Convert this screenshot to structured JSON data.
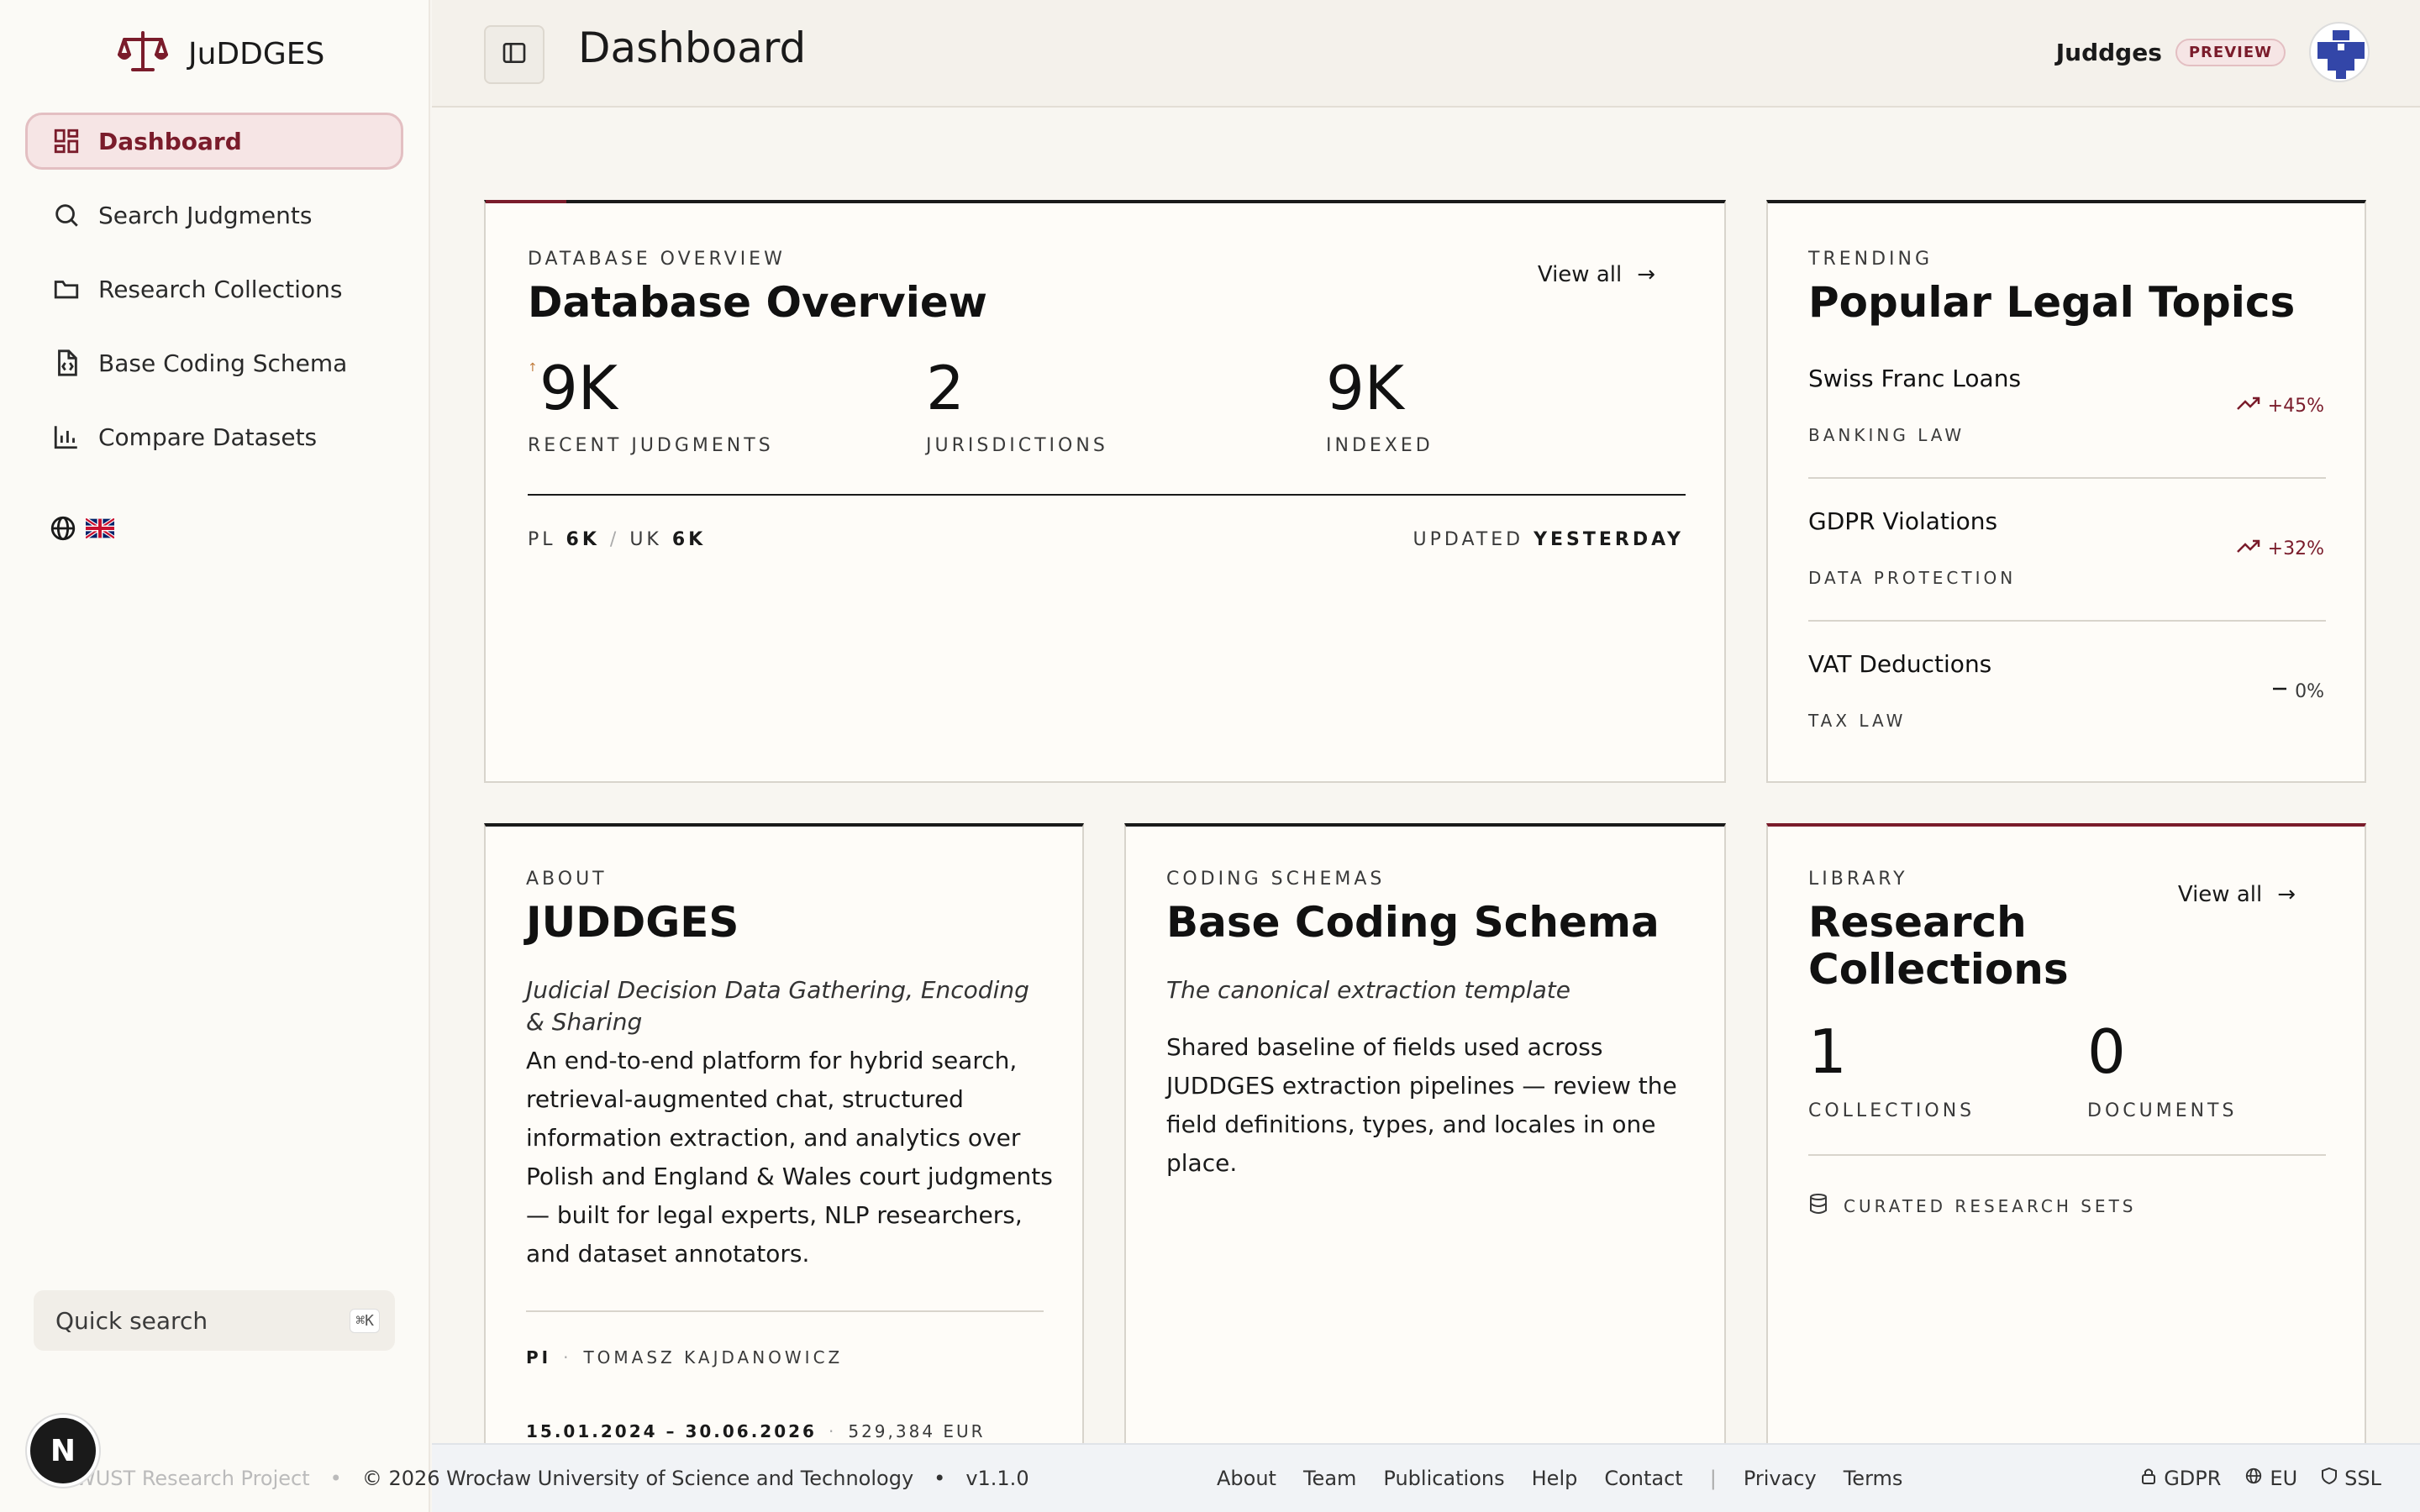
{
  "brand": {
    "name": "JuDDGES"
  },
  "sidebar": {
    "items": [
      {
        "label": "Dashboard",
        "icon": "grid-icon",
        "active": true
      },
      {
        "label": "Search Judgments",
        "icon": "search-icon"
      },
      {
        "label": "Research Collections",
        "icon": "folder-icon"
      },
      {
        "label": "Base Coding Schema",
        "icon": "file-code-icon"
      },
      {
        "label": "Compare Datasets",
        "icon": "bar-chart-icon"
      }
    ],
    "quick_search": {
      "label": "Quick search",
      "shortcut": "⌘K"
    },
    "avatar_letter": "N"
  },
  "header": {
    "title": "Dashboard",
    "user_name": "Juddges",
    "badge": "PREVIEW"
  },
  "overview": {
    "eyebrow": "DATABASE OVERVIEW",
    "title": "Database Overview",
    "view_all": "View all",
    "arrow": "→",
    "marker": "↑",
    "stats": [
      {
        "value": "9K",
        "label": "RECENT JUDGMENTS"
      },
      {
        "value": "2",
        "label": "JURISDICTIONS"
      },
      {
        "value": "9K",
        "label": "INDEXED"
      }
    ],
    "breakdown": {
      "pl_label": "PL",
      "pl_value": "6K",
      "sep": "/",
      "uk_label": "UK",
      "uk_value": "6K"
    },
    "updated_label": "UPDATED",
    "updated_value": "YESTERDAY"
  },
  "trending": {
    "eyebrow": "TRENDING",
    "title": "Popular Legal Topics",
    "topics": [
      {
        "name": "Swiss Franc Loans",
        "category": "BANKING LAW",
        "change": "+45%",
        "trend": "up"
      },
      {
        "name": "GDPR Violations",
        "category": "DATA PROTECTION",
        "change": "+32%",
        "trend": "up"
      },
      {
        "name": "VAT Deductions",
        "category": "TAX LAW",
        "change": "0%",
        "trend": "flat"
      }
    ]
  },
  "about": {
    "eyebrow": "ABOUT",
    "title": "JUDDGES",
    "subtitle": "Judicial Decision Data Gathering, Encoding & Sharing",
    "body": "An end-to-end platform for hybrid search, retrieval-augmented chat, structured information extraction, and analytics over Polish and England & Wales court judgments — built for legal experts, NLP researchers, and dataset annotators.",
    "pi_label": "PI",
    "pi_sep": "·",
    "pi_name": "TOMASZ KAJDANOWICZ",
    "dates": "15.01.2024 – 30.06.2026",
    "dates_sep": "·",
    "budget": "529,384 EUR"
  },
  "schema": {
    "eyebrow": "CODING SCHEMAS",
    "title": "Base Coding Schema",
    "subtitle": "The canonical extraction template",
    "body": "Shared baseline of fields used across JUDDGES extraction pipelines — review the field definitions, types, and locales in one place."
  },
  "library": {
    "eyebrow": "LIBRARY",
    "title": "Research Collections",
    "view_all": "View all",
    "arrow": "→",
    "stats": [
      {
        "value": "1",
        "label": "COLLECTIONS"
      },
      {
        "value": "0",
        "label": "DOCUMENTS"
      }
    ],
    "footer_label": "CURATED RESEARCH SETS"
  },
  "footer": {
    "project": "WUST Research Project",
    "bullet": "•",
    "copyright": "© 2026 Wrocław University of Science and Technology",
    "version": "v1.1.0",
    "links": [
      "About",
      "Team",
      "Publications",
      "Help",
      "Contact"
    ],
    "divider": "|",
    "legal": [
      "Privacy",
      "Terms"
    ],
    "badges": [
      "GDPR",
      "EU",
      "SSL"
    ]
  },
  "colors": {
    "accent": "#7a1c2b",
    "accent_bg": "#f6e5e5",
    "avatar_blue": "#3346a8"
  }
}
